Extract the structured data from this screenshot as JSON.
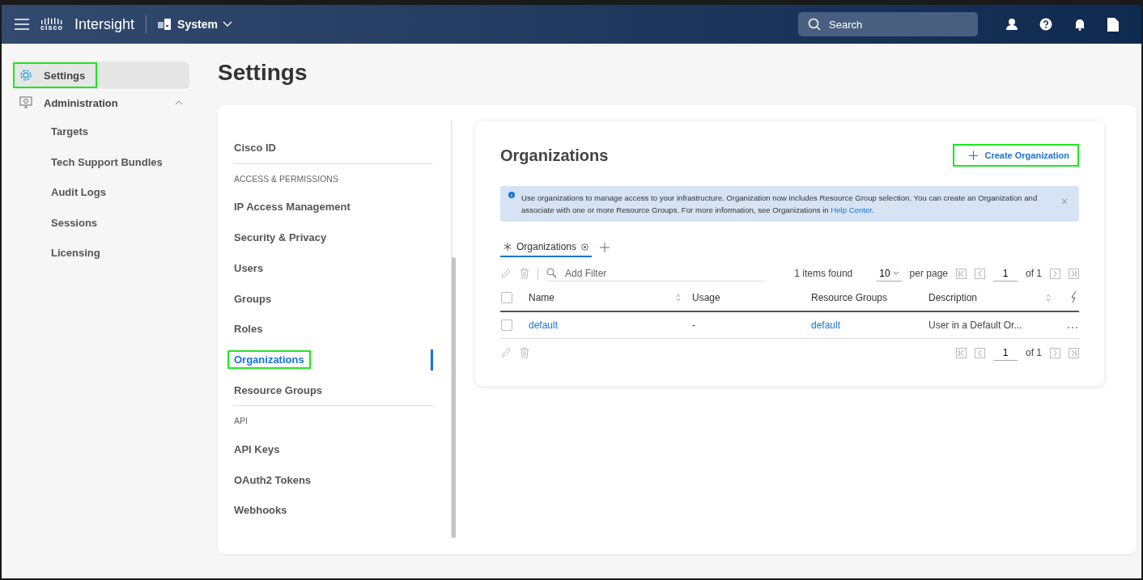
{
  "header": {
    "brand_mark": "cisco",
    "brand": "Intersight",
    "scope": "System",
    "search": {
      "placeholder": "Search"
    }
  },
  "sidebar": {
    "items": [
      {
        "kind": "link",
        "label": "Settings",
        "selected": true,
        "highlighted": true
      },
      {
        "kind": "group",
        "label": "Administration",
        "expanded": true,
        "children": [
          {
            "label": "Targets"
          },
          {
            "label": "Tech Support Bundles"
          },
          {
            "label": "Audit Logs"
          },
          {
            "label": "Sessions"
          },
          {
            "label": "Licensing"
          }
        ]
      }
    ]
  },
  "page_title": "Settings",
  "settings_nav": [
    {
      "kind": "item",
      "label": "Cisco ID",
      "selected": false,
      "highlighted": false
    },
    {
      "kind": "section",
      "label": "ACCESS & PERMISSIONS"
    },
    {
      "kind": "item",
      "label": "IP Access Management",
      "selected": false,
      "highlighted": false
    },
    {
      "kind": "item",
      "label": "Security & Privacy",
      "selected": false,
      "highlighted": false
    },
    {
      "kind": "item",
      "label": "Users",
      "selected": false,
      "highlighted": false
    },
    {
      "kind": "item",
      "label": "Groups",
      "selected": false,
      "highlighted": false
    },
    {
      "kind": "item",
      "label": "Roles",
      "selected": false,
      "highlighted": false
    },
    {
      "kind": "item",
      "label": "Organizations",
      "selected": true,
      "highlighted": true
    },
    {
      "kind": "item",
      "label": "Resource Groups",
      "selected": false,
      "highlighted": false
    },
    {
      "kind": "section",
      "label": "API"
    },
    {
      "kind": "item",
      "label": "API Keys",
      "selected": false,
      "highlighted": false
    },
    {
      "kind": "item",
      "label": "OAuth2 Tokens",
      "selected": false,
      "highlighted": false
    },
    {
      "kind": "item",
      "label": "Webhooks",
      "selected": false,
      "highlighted": false
    }
  ],
  "panel": {
    "title": "Organizations",
    "create_button": {
      "label": "Create Organization",
      "highlighted": true
    },
    "banner": {
      "text": "Use organizations to manage access to your infrastructure. Organization now includes Resource Group selection. You can create an Organization and associate with one or more Resource Groups. For more information, see Organizations in",
      "link": "Help Center",
      "suffix": "."
    },
    "tabs": [
      {
        "label": "Organizations",
        "selected": true
      }
    ],
    "toolbar": {
      "filter_placeholder": "Add Filter",
      "items_found": "1 items found",
      "per_page_value": "10",
      "per_page_label": "per page",
      "page": "1",
      "page_count": "of 1"
    },
    "table": {
      "columns": [
        {
          "label": "Name",
          "kind": "sortable"
        },
        {
          "label": "Usage",
          "kind": "plain"
        },
        {
          "label": "Resource Groups",
          "kind": "plain"
        },
        {
          "label": "Description",
          "kind": "sortable"
        }
      ],
      "header_checked": false,
      "rows": [
        {
          "checked": false,
          "name": "default",
          "usage": "-",
          "resource_groups": "default",
          "description": "User in a Default Or..."
        }
      ]
    },
    "footer": {
      "page": "1",
      "page_count": "of 1"
    }
  }
}
